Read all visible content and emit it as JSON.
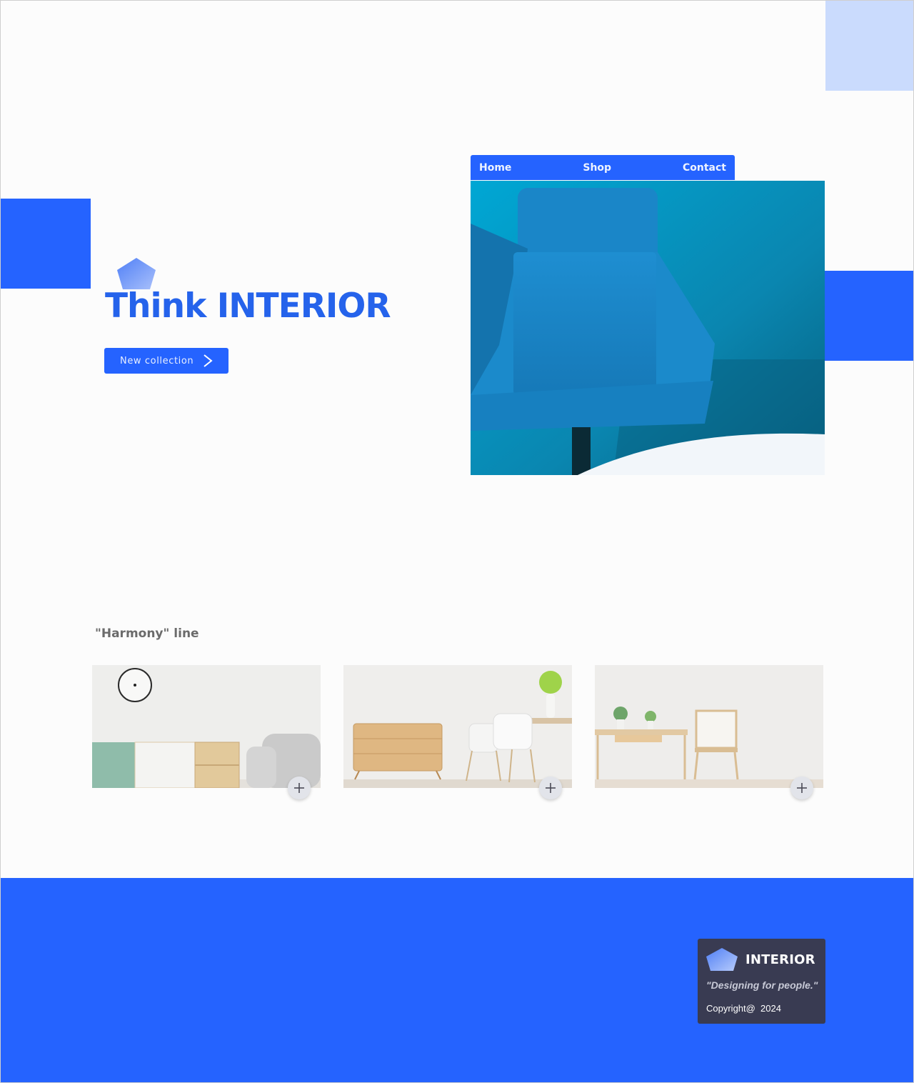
{
  "nav": {
    "items": [
      "Home",
      "Shop",
      "Contact"
    ]
  },
  "hero": {
    "title": "Think INTERIOR",
    "cta_label": "New collection",
    "image": "blue-armchair-photo"
  },
  "collection": {
    "title": "\"Harmony\" line",
    "cards": [
      {
        "image": "sideboard-and-sofa-room",
        "action_icon": "plus-icon"
      },
      {
        "image": "dresser-and-dining-chairs-room",
        "action_icon": "plus-icon"
      },
      {
        "image": "desk-and-chair-room",
        "action_icon": "plus-icon"
      }
    ]
  },
  "footer": {
    "brand": "INTERIOR",
    "tagline": "\"Designing for people.\"",
    "copyright": "Copyright@  2024"
  },
  "colors": {
    "accent": "#2563ff",
    "accent_light": "#99b6ff",
    "accent_pale": "#cadbfd",
    "title": "#2563eb",
    "footer_card": "#393b52"
  }
}
